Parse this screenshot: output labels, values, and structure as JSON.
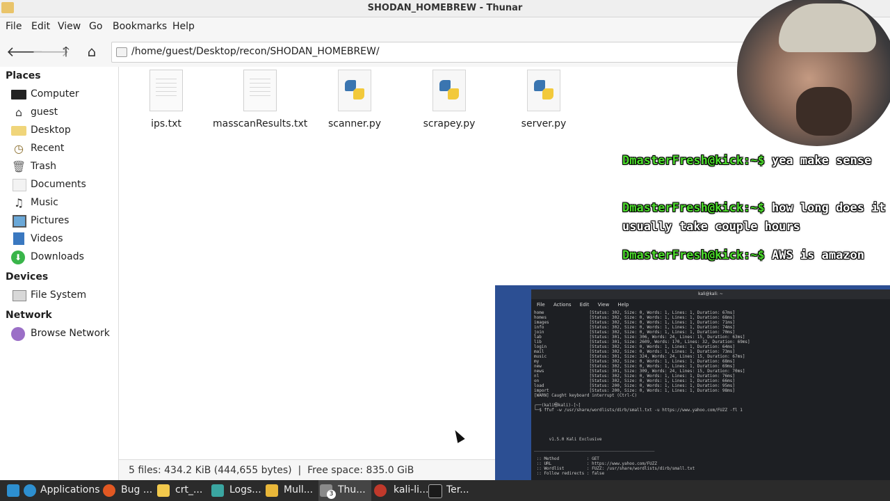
{
  "window": {
    "title": "SHODAN_HOMEBREW - Thunar"
  },
  "menu": [
    "File",
    "Edit",
    "View",
    "Go",
    "Bookmarks",
    "Help"
  ],
  "toolbar": {
    "path": "/home/guest/Desktop/recon/SHODAN_HOMEBREW/"
  },
  "sidebar": {
    "places_label": "Places",
    "places": [
      {
        "label": "Computer",
        "icon": "monitor-icon"
      },
      {
        "label": "guest",
        "icon": "home-folder-icon"
      },
      {
        "label": "Desktop",
        "icon": "folder-icon"
      },
      {
        "label": "Recent",
        "icon": "clock-icon"
      },
      {
        "label": "Trash",
        "icon": "trash-icon"
      },
      {
        "label": "Documents",
        "icon": "documents-icon"
      },
      {
        "label": "Music",
        "icon": "music-note-icon"
      },
      {
        "label": "Pictures",
        "icon": "pictures-icon"
      },
      {
        "label": "Videos",
        "icon": "film-icon"
      },
      {
        "label": "Downloads",
        "icon": "download-icon"
      }
    ],
    "devices_label": "Devices",
    "devices": [
      {
        "label": "File System",
        "icon": "drive-icon"
      }
    ],
    "network_label": "Network",
    "network": [
      {
        "label": "Browse Network",
        "icon": "network-icon"
      }
    ]
  },
  "files": [
    {
      "name": "ips.txt",
      "type": "text"
    },
    {
      "name": "masscanResults.txt",
      "type": "text"
    },
    {
      "name": "scanner.py",
      "type": "python"
    },
    {
      "name": "scrapey.py",
      "type": "python"
    },
    {
      "name": "server.py",
      "type": "python"
    }
  ],
  "status": {
    "text": "5 files: 434.2 KiB (444,655 bytes)  |  Free space: 835.0 GiB"
  },
  "chat": [
    {
      "user": "DmasterFresh@kick:~$",
      "message": "yea make sense"
    },
    {
      "user": "DmasterFresh@kick:~$",
      "message": "how long does it usually take couple hours"
    },
    {
      "user": "DmasterFresh@kick:~$",
      "message": "AWS is amazon"
    }
  ],
  "terminal": {
    "title": "kali@kali: ~",
    "menu": [
      "File",
      "Actions",
      "Edit",
      "View",
      "Help"
    ],
    "output": "home                  [Status: 302, Size: 0, Words: 1, Lines: 1, Duration: 67ms]\nhomes                 [Status: 302, Size: 0, Words: 1, Lines: 1, Duration: 68ms]\nimages                [Status: 302, Size: 0, Words: 1, Lines: 1, Duration: 71ms]\ninfo                  [Status: 302, Size: 0, Words: 1, Lines: 1, Duration: 74ms]\njoin                  [Status: 302, Size: 0, Words: 1, Lines: 1, Duration: 70ms]\nlab                   [Status: 301, Size: 306, Words: 24, Lines: 15, Duration: 63ms]\nlib                   [Status: 301, Size: 2609, Words: 170, Lines: 32, Duration: 69ms]\nlogin                 [Status: 302, Size: 0, Words: 1, Lines: 1, Duration: 64ms]\nmail                  [Status: 302, Size: 0, Words: 1, Lines: 1, Duration: 73ms]\nmusic                 [Status: 301, Size: 324, Words: 24, Lines: 15, Duration: 67ms]\nmy                    [Status: 302, Size: 0, Words: 1, Lines: 1, Duration: 68ms]\nnew                   [Status: 302, Size: 0, Words: 1, Lines: 1, Duration: 69ms]\nnews                  [Status: 301, Size: 309, Words: 24, Lines: 15, Duration: 70ms]\nnl                    [Status: 302, Size: 0, Words: 1, Lines: 1, Duration: 76ms]\non                    [Status: 302, Size: 0, Words: 1, Lines: 1, Duration: 66ms]\nload                  [Status: 200, Size: 0, Words: 1, Lines: 1, Duration: 95ms]\nimport                [Status: 200, Size: 0, Words: 1, Lines: 1, Duration: 98ms]\n[WARN] Caught keyboard interrupt (Ctrl-C)\n\n┌──(kali㉿kali)-[~]\n└─$ ffuf -w /usr/share/wordlists/dirb/small.txt -u https://www.yahoo.com/FUZZ -fl 1\n\n\n\n\n\n      v1.5.0 Kali Exclusive\n\n________________________________________________\n\n :: Method           : GET\n :: URL              : https://www.yahoo.com/FUZZ\n :: Wordlist         : FUZZ: /usr/share/wordlists/dirb/small.txt\n :: Follow redirects : false"
  },
  "taskbar": [
    {
      "label": "Applications",
      "icon": "kali-dragon-icon",
      "color": "#2d8fd0"
    },
    {
      "label": "Bug ...",
      "icon": "firefox-icon",
      "color": "#e25822"
    },
    {
      "label": "crt_...",
      "icon": "text-editor-icon",
      "color": "#f2c94c"
    },
    {
      "label": "Logs...",
      "icon": "logs-icon",
      "color": "#3aa6a1"
    },
    {
      "label": "Mull...",
      "icon": "mullvad-icon",
      "color": "#e9b739"
    },
    {
      "label": "Thu...",
      "icon": "thunar-icon",
      "color": "#8a8a8a",
      "badge": "3"
    },
    {
      "label": "kali-li...",
      "icon": "vm-icon",
      "color": "#c0392b"
    },
    {
      "label": "Ter...",
      "icon": "terminal-icon",
      "color": "#333333"
    }
  ]
}
